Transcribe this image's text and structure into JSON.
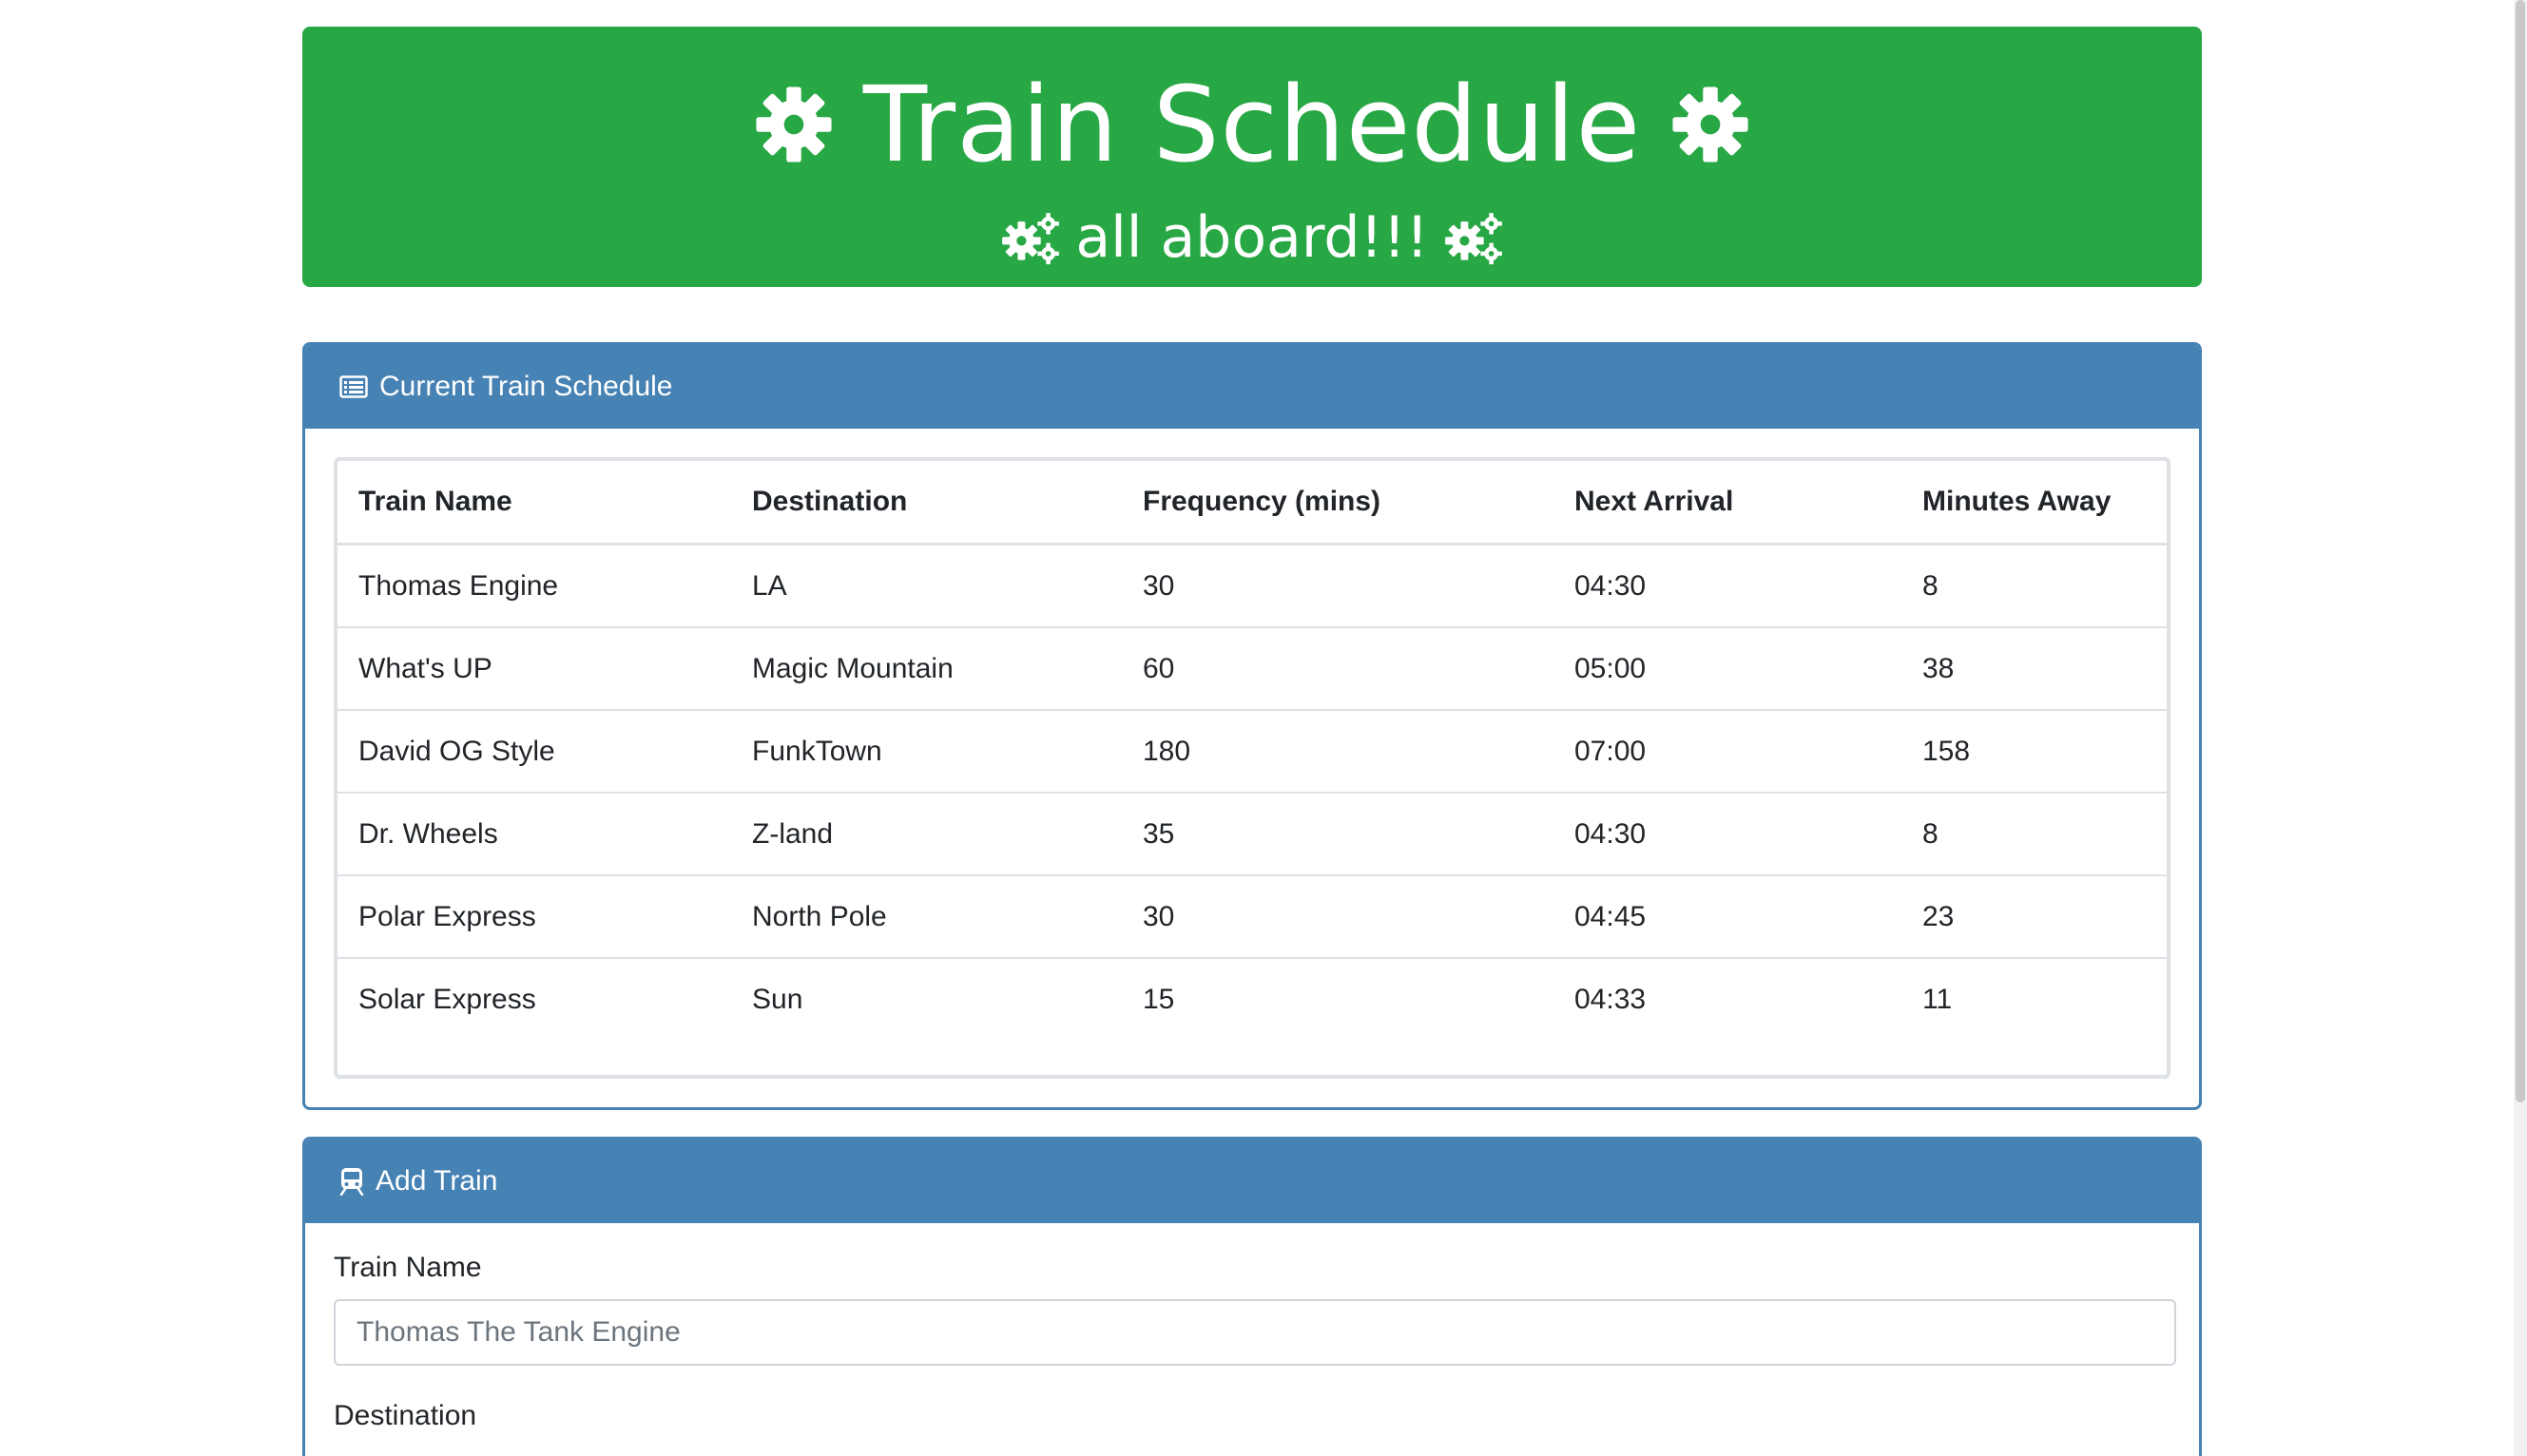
{
  "header": {
    "title": "Train Schedule",
    "subtitle": "all aboard!!!",
    "title_icon": "cog-icon",
    "subtitle_icon": "cogs-icon",
    "background_color": "#28a745"
  },
  "schedule_panel": {
    "heading": "Current Train Schedule",
    "icon": "list-alt-icon",
    "accent_color": "#4682b4",
    "columns": [
      "Train Name",
      "Destination",
      "Frequency (mins)",
      "Next Arrival",
      "Minutes Away"
    ],
    "rows": [
      [
        "Thomas Engine",
        "LA",
        "30",
        "04:30",
        "8"
      ],
      [
        "What's UP",
        "Magic Mountain",
        "60",
        "05:00",
        "38"
      ],
      [
        "David OG Style",
        "FunkTown",
        "180",
        "07:00",
        "158"
      ],
      [
        "Dr. Wheels",
        "Z-land",
        "35",
        "04:30",
        "8"
      ],
      [
        "Polar Express",
        "North Pole",
        "30",
        "04:45",
        "23"
      ],
      [
        "Solar Express",
        "Sun",
        "15",
        "04:33",
        "11"
      ]
    ]
  },
  "add_panel": {
    "heading": "Add Train",
    "icon": "train-icon",
    "fields": {
      "train_name": {
        "label": "Train Name",
        "placeholder": "Thomas The Tank Engine",
        "value": ""
      },
      "destination": {
        "label": "Destination"
      }
    }
  }
}
